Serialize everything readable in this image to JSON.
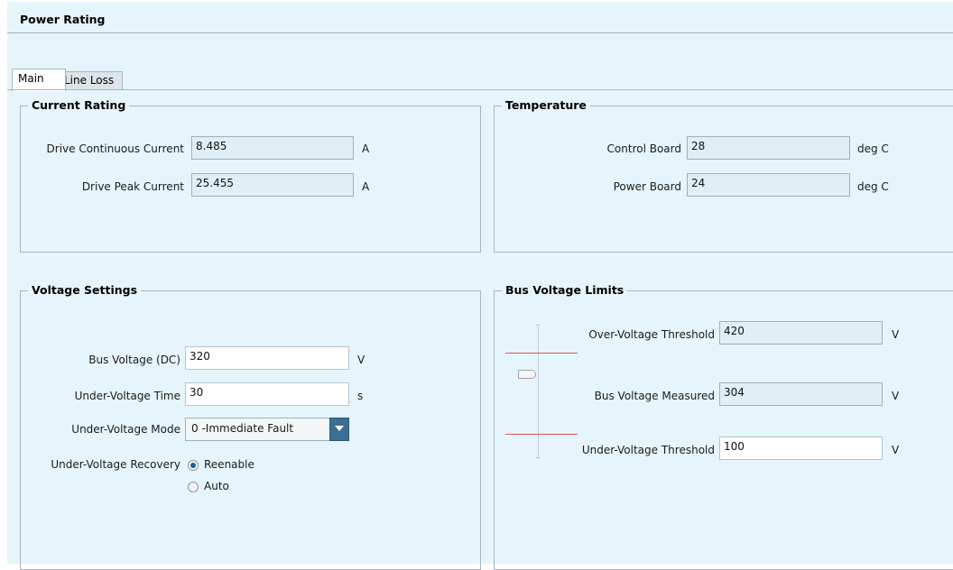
{
  "window": {
    "title": "Power Rating"
  },
  "tabs": {
    "main": "Main",
    "line_loss": "Line Loss"
  },
  "current_rating": {
    "title": "Current Rating",
    "continuous_label": "Drive Continuous Current",
    "continuous_value": "8.485",
    "continuous_unit": "A",
    "peak_label": "Drive Peak Current",
    "peak_value": "25.455",
    "peak_unit": "A"
  },
  "temperature": {
    "title": "Temperature",
    "control_label": "Control Board",
    "control_value": "28",
    "control_unit": "deg C",
    "power_label": "Power Board",
    "power_value": "24",
    "power_unit": "deg C"
  },
  "voltage_settings": {
    "title": "Voltage Settings",
    "bus_label": "Bus Voltage (DC)",
    "bus_value": "320",
    "bus_unit": "V",
    "uv_time_label": "Under-Voltage Time",
    "uv_time_value": "30",
    "uv_time_unit": "s",
    "uv_mode_label": "Under-Voltage Mode",
    "uv_mode_value": "0 -Immediate Fault",
    "uv_recovery_label": "Under-Voltage Recovery",
    "recovery_options": [
      "Reenable",
      "Auto"
    ],
    "recovery_selected": "Reenable"
  },
  "bus_voltage_limits": {
    "title": "Bus Voltage Limits",
    "ov_label": "Over-Voltage Threshold",
    "ov_value": "420",
    "ov_unit": "V",
    "measured_label": "Bus Voltage Measured",
    "measured_value": "304",
    "measured_unit": "V",
    "uv_label": "Under-Voltage Threshold",
    "uv_value": "100",
    "uv_unit": "V"
  },
  "colors": {
    "panel_bg": "#e6f5fb",
    "accent": "#3d6f93",
    "limit_line": "#e05555"
  }
}
